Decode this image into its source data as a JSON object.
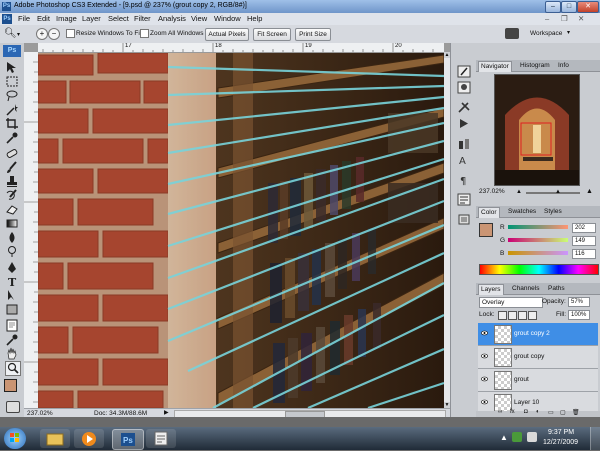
{
  "window": {
    "title": "Adobe Photoshop CS3 Extended - [9.psd @ 237% (grout copy 2, RGB/8#)]",
    "minimize": "–",
    "maximize": "□",
    "close": "✕"
  },
  "menu": [
    "File",
    "Edit",
    "Image",
    "Layer",
    "Select",
    "Filter",
    "Analysis",
    "View",
    "Window",
    "Help"
  ],
  "options_bar": {
    "resize_windows": "Resize Windows To Fit",
    "zoom_all": "Zoom All Windows",
    "actual_pixels": "Actual Pixels",
    "fit_screen": "Fit Screen",
    "print_size": "Print Size",
    "workspace": "Workspace"
  },
  "ruler": {
    "top_ticks": [
      "17",
      "18",
      "19",
      "20",
      "21",
      "22",
      "23"
    ]
  },
  "status": {
    "zoom": "237.02%",
    "doc": "Doc: 34.3M/88.6M"
  },
  "navigator": {
    "tabs": [
      "Navigator",
      "Histogram",
      "Info"
    ],
    "zoom": "237.02%"
  },
  "color_panel": {
    "tabs": [
      "Color",
      "Swatches",
      "Styles"
    ],
    "r": "202",
    "g": "149",
    "b": "116",
    "r_label": "R",
    "g_label": "G",
    "b_label": "B",
    "swatch": "#ca9574"
  },
  "layers_panel": {
    "tabs": [
      "Layers",
      "Channels",
      "Paths"
    ],
    "blend_mode": "Overlay",
    "opacity_label": "Opacity:",
    "opacity": "57%",
    "lock_label": "Lock:",
    "fill_label": "Fill:",
    "fill": "100%",
    "layers": [
      {
        "name": "grout copy 2",
        "selected": true
      },
      {
        "name": "grout copy",
        "selected": false
      },
      {
        "name": "grout",
        "selected": false
      },
      {
        "name": "Layer 10",
        "selected": false
      }
    ]
  },
  "taskbar": {
    "time": "9:37 PM",
    "date": "12/27/2009"
  },
  "colors": {
    "accent": "#3f8ee6",
    "selection": "#3f8ee6"
  }
}
